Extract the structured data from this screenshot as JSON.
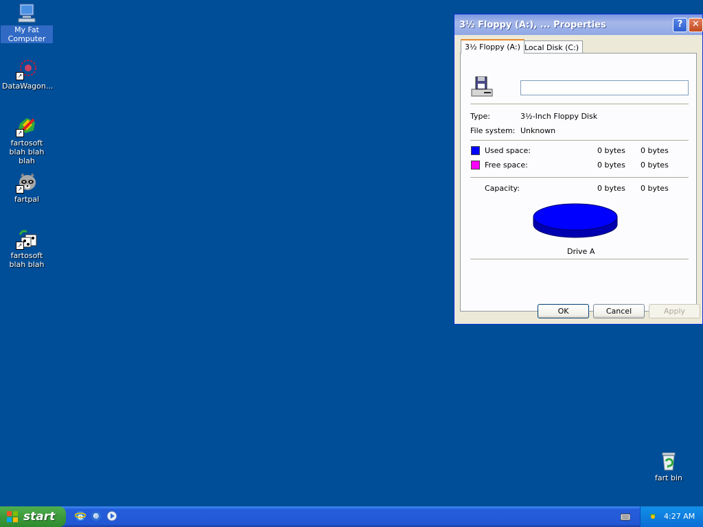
{
  "desktop": {
    "icons": [
      {
        "label": "My Fat Computer",
        "icon": "computer-icon"
      },
      {
        "label": "DataWagon...",
        "icon": "datawagon-icon"
      },
      {
        "label": "fartosoft blah blah blah",
        "icon": "fartosoft-icon"
      },
      {
        "label": "fartpal",
        "icon": "raccoon-icon"
      },
      {
        "label": "fartosoft blah blah",
        "icon": "fartosoft-games-icon"
      },
      {
        "label": "fart bin",
        "icon": "recycle-bin-icon"
      }
    ]
  },
  "dialog": {
    "title": "3½ Floppy (A:), ... Properties",
    "help_glyph": "?",
    "close_glyph": "✕",
    "tabs": [
      {
        "label": "3½ Floppy (A:)",
        "active": true
      },
      {
        "label": "Local Disk (C:)",
        "active": false
      }
    ],
    "name_value": "",
    "type_label": "Type:",
    "type_value": "3½-Inch Floppy Disk",
    "fs_label": "File system:",
    "fs_value": "Unknown",
    "used_label": "Used space:",
    "used_bytes": "0 bytes",
    "used_size": "0 bytes",
    "free_label": "Free space:",
    "free_bytes": "0 bytes",
    "free_size": "0 bytes",
    "capacity_label": "Capacity:",
    "capacity_bytes": "0 bytes",
    "capacity_size": "0 bytes",
    "drive_label": "Drive A",
    "colors": {
      "used": "#0000FF",
      "free": "#FF00FF"
    },
    "buttons": {
      "ok": "OK",
      "cancel": "Cancel",
      "apply": "Apply"
    }
  },
  "taskbar": {
    "start_label": "start",
    "quick_launch": [
      "internet-explorer-icon",
      "outlook-express-icon",
      "media-player-icon"
    ],
    "clock": "4:27 AM"
  }
}
